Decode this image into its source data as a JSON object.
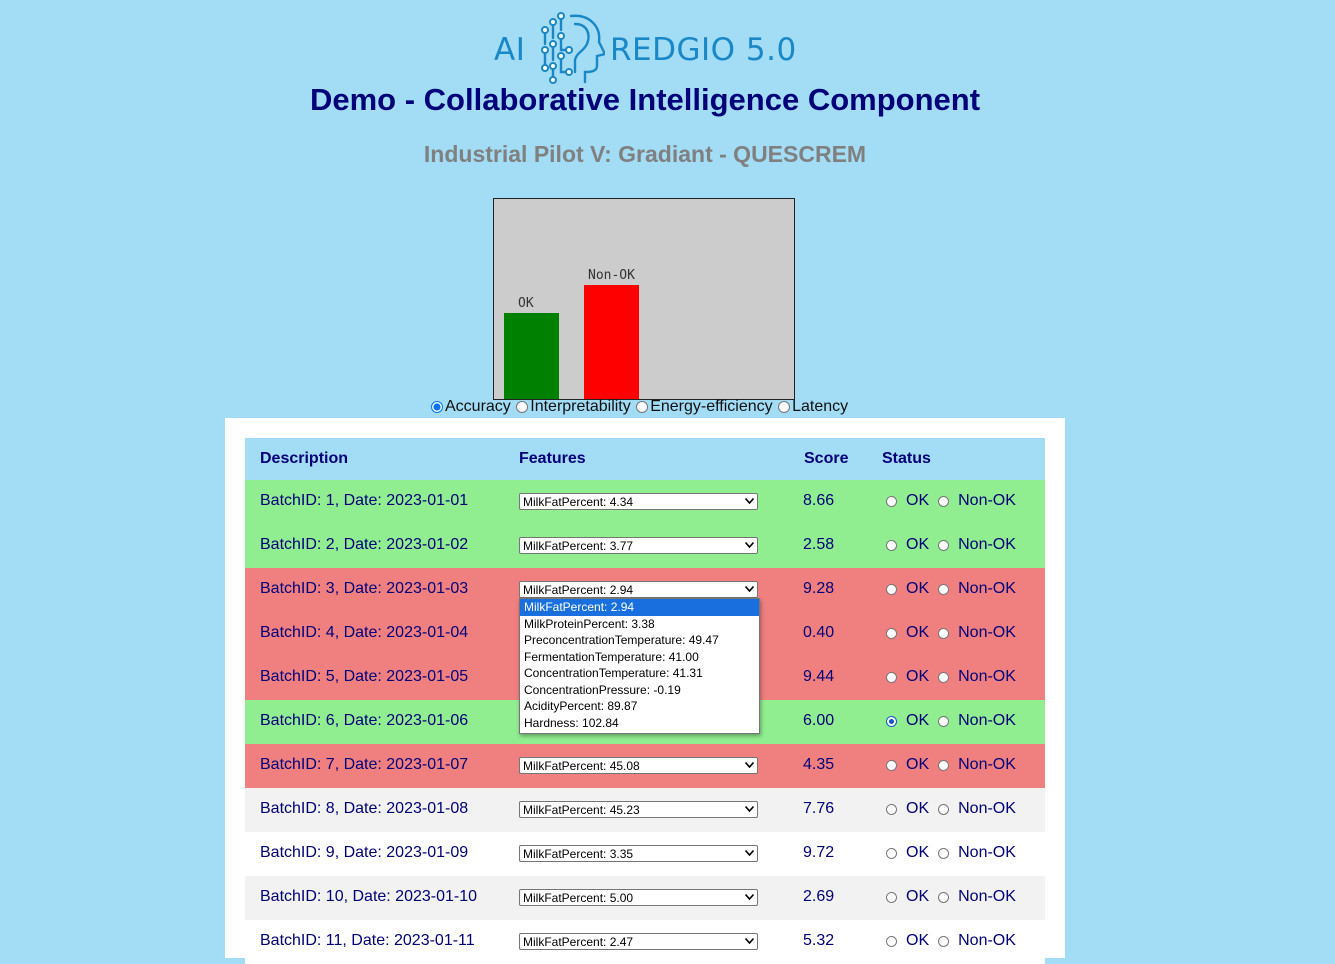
{
  "logo": {
    "left_text": "AI",
    "right_text": "REDGIO 5.0"
  },
  "title": "Demo - Collaborative Intelligence Component",
  "subtitle": "Industrial Pilot V: Gradiant - QUESCREM",
  "chart_data": {
    "type": "bar",
    "categories": [
      "OK",
      "Non-OK"
    ],
    "values": [
      86,
      114
    ],
    "colors": [
      "#008000",
      "#ff0000"
    ],
    "ylim": [
      0,
      200
    ],
    "title": "",
    "xlabel": "",
    "ylabel": "",
    "grid": false
  },
  "metrics": {
    "selected": "Accuracy",
    "options": [
      "Accuracy",
      "Interpretability",
      "Energy-efficiency",
      "Latency"
    ]
  },
  "table": {
    "headers": {
      "description": "Description",
      "features": "Features",
      "score": "Score",
      "status": "Status"
    },
    "ok_label": "OK",
    "nonok_label": "Non-OK",
    "rows": [
      {
        "description": "BatchID: 1, Date: 2023-01-01",
        "feature": "MilkFatPercent: 4.34",
        "score": "8.66",
        "color": "green",
        "status": ""
      },
      {
        "description": "BatchID: 2, Date: 2023-01-02",
        "feature": "MilkFatPercent: 3.77",
        "score": "2.58",
        "color": "green",
        "status": ""
      },
      {
        "description": "BatchID: 3, Date: 2023-01-03",
        "feature": "MilkFatPercent: 2.94",
        "score": "9.28",
        "color": "red",
        "status": ""
      },
      {
        "description": "BatchID: 4, Date: 2023-01-04",
        "feature": "",
        "score": "0.40",
        "color": "red",
        "status": ""
      },
      {
        "description": "BatchID: 5, Date: 2023-01-05",
        "feature": "",
        "score": "9.44",
        "color": "red",
        "status": ""
      },
      {
        "description": "BatchID: 6, Date: 2023-01-06",
        "feature": "",
        "score": "6.00",
        "color": "green",
        "status": "OK"
      },
      {
        "description": "BatchID: 7, Date: 2023-01-07",
        "feature": "MilkFatPercent: 45.08",
        "score": "4.35",
        "color": "red",
        "status": ""
      },
      {
        "description": "BatchID: 8, Date: 2023-01-08",
        "feature": "MilkFatPercent: 45.23",
        "score": "7.76",
        "color": "grey",
        "status": ""
      },
      {
        "description": "BatchID: 9, Date: 2023-01-09",
        "feature": "MilkFatPercent: 3.35",
        "score": "9.72",
        "color": "white",
        "status": ""
      },
      {
        "description": "BatchID: 10, Date: 2023-01-10",
        "feature": "MilkFatPercent: 5.00",
        "score": "2.69",
        "color": "grey",
        "status": ""
      },
      {
        "description": "BatchID: 11, Date: 2023-01-11",
        "feature": "MilkFatPercent: 2.47",
        "score": "5.32",
        "color": "white",
        "status": ""
      }
    ]
  },
  "dropdown": {
    "selected_index": 0,
    "options": [
      "MilkFatPercent: 2.94",
      "MilkProteinPercent: 3.38",
      "PreconcentrationTemperature: 49.47",
      "FermentationTemperature: 41.00",
      "ConcentrationTemperature: 41.31",
      "ConcentrationPressure: -0.19",
      "AcidityPercent: 89.87",
      "Hardness: 102.84"
    ]
  }
}
